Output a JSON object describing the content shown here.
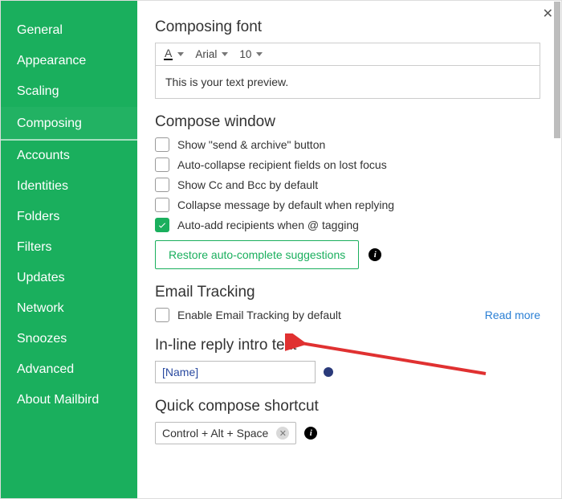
{
  "sidebar": {
    "items": [
      {
        "label": "General"
      },
      {
        "label": "Appearance"
      },
      {
        "label": "Scaling"
      },
      {
        "label": "Composing"
      },
      {
        "label": "Accounts"
      },
      {
        "label": "Identities"
      },
      {
        "label": "Folders"
      },
      {
        "label": "Filters"
      },
      {
        "label": "Updates"
      },
      {
        "label": "Network"
      },
      {
        "label": "Snoozes"
      },
      {
        "label": "Advanced"
      },
      {
        "label": "About Mailbird"
      }
    ],
    "active_index": 3
  },
  "sections": {
    "composing_font": {
      "title": "Composing font",
      "font_family": "Arial",
      "font_size": "10",
      "preview": "This is your text preview."
    },
    "compose_window": {
      "title": "Compose window",
      "options": [
        {
          "label": "Show \"send & archive\" button",
          "checked": false
        },
        {
          "label": "Auto-collapse recipient fields on lost focus",
          "checked": false
        },
        {
          "label": "Show Cc and Bcc by default",
          "checked": false
        },
        {
          "label": "Collapse message by default when replying",
          "checked": false
        },
        {
          "label": "Auto-add recipients when @ tagging",
          "checked": true
        }
      ],
      "restore_label": "Restore auto-complete suggestions"
    },
    "email_tracking": {
      "title": "Email Tracking",
      "enable_label": "Enable Email Tracking by default",
      "enable_checked": false,
      "read_more": "Read more"
    },
    "inline_reply": {
      "title": "In-line reply intro text",
      "value": "[Name]"
    },
    "quick_compose": {
      "title": "Quick compose shortcut",
      "value": "Control + Alt + Space"
    }
  }
}
